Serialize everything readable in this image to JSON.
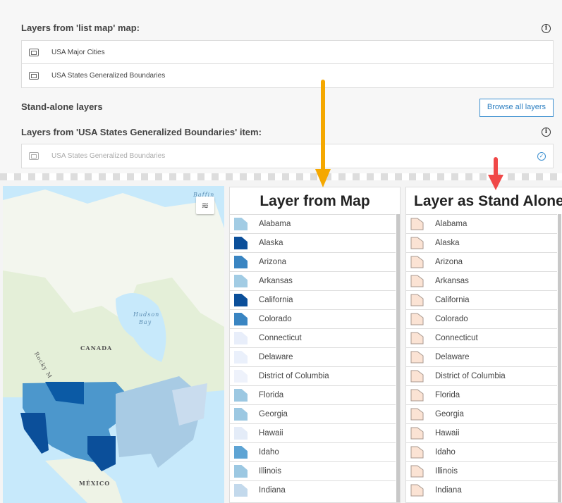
{
  "top": {
    "map_layers_heading": "Layers from 'list map' map:",
    "map_layers": [
      "USA Major Cities",
      "USA States Generalized Boundaries"
    ],
    "standalone_heading": "Stand-alone layers",
    "browse_button": "Browse all layers",
    "item_layers_heading": "Layers from 'USA States Generalized Boundaries' item:",
    "item_layers": [
      "USA States Generalized Boundaries"
    ]
  },
  "map": {
    "labels": {
      "canada": "CANADA",
      "hudson": "Hudson",
      "bay": "Bay",
      "mexico": "MÉXICO",
      "rocky": "Rocky M",
      "baffin": "Baffin"
    }
  },
  "colors": {
    "arrow_left": "#f5a800",
    "arrow_right": "#f04848",
    "standalone_fill": "#fbe3d4"
  },
  "panels": {
    "from_map": {
      "title": "Layer from Map",
      "items": [
        {
          "name": "Alabama",
          "color": "#a2cce4"
        },
        {
          "name": "Alaska",
          "color": "#0b4f9a"
        },
        {
          "name": "Arizona",
          "color": "#3a85c2"
        },
        {
          "name": "Arkansas",
          "color": "#a2cce4"
        },
        {
          "name": "California",
          "color": "#0b4f9a"
        },
        {
          "name": "Colorado",
          "color": "#3a85c2"
        },
        {
          "name": "Connecticut",
          "color": "#e8eefa"
        },
        {
          "name": "Delaware",
          "color": "#eaf0fb"
        },
        {
          "name": "District of Columbia",
          "color": "#eef2fb"
        },
        {
          "name": "Florida",
          "color": "#9cc8e2"
        },
        {
          "name": "Georgia",
          "color": "#9cc8e2"
        },
        {
          "name": "Hawaii",
          "color": "#e4ecf8"
        },
        {
          "name": "Idaho",
          "color": "#5ea4d4"
        },
        {
          "name": "Illinois",
          "color": "#9cc8e2"
        },
        {
          "name": "Indiana",
          "color": "#c3d9ec"
        }
      ]
    },
    "stand_alone": {
      "title": "Layer as Stand Alone",
      "items": [
        "Alabama",
        "Alaska",
        "Arizona",
        "Arkansas",
        "California",
        "Colorado",
        "Connecticut",
        "Delaware",
        "District of Columbia",
        "Florida",
        "Georgia",
        "Hawaii",
        "Idaho",
        "Illinois",
        "Indiana"
      ]
    }
  }
}
